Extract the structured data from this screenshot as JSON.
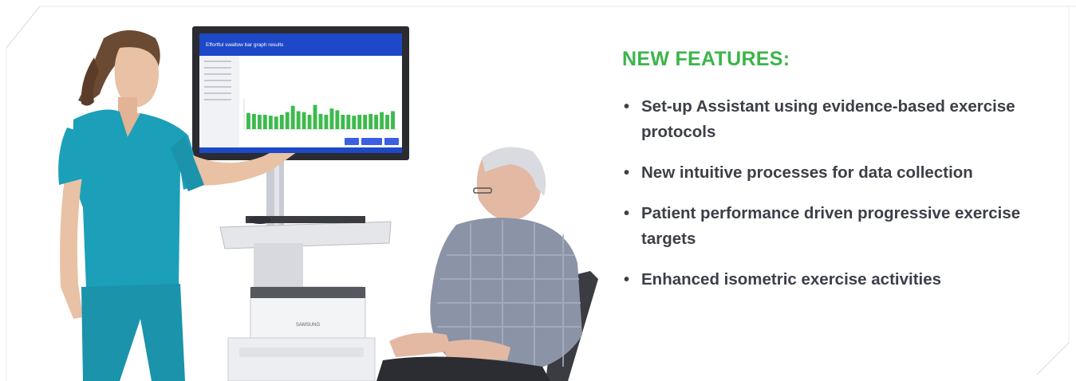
{
  "features": {
    "title": "NEW FEATURES:",
    "items": [
      {
        "label": "Set-up Assistant using evidence-based exercise protocols"
      },
      {
        "label": "New intuitive processes for data collection"
      },
      {
        "label": "Patient performance driven progressive exercise targets"
      },
      {
        "label": "Enhanced isometric exercise activities"
      }
    ]
  },
  "screen": {
    "title": "Effortful swallow bar graph results",
    "chart": {
      "values": [
        18,
        17,
        16,
        16,
        15,
        14,
        16,
        19,
        26,
        20,
        19,
        16,
        27,
        17,
        16,
        23,
        21,
        16,
        16,
        15,
        16,
        16,
        17,
        16,
        19,
        16,
        20
      ],
      "ymax": 32,
      "bar_color": "#3dbb4c"
    }
  },
  "colors": {
    "accent_green": "#3cb54a",
    "text_dark": "#3c3f48",
    "screen_blue": "#1d48c7",
    "scrub_teal": "#1c9fb8"
  },
  "device": {
    "printer_brand": "SAMSUNG"
  }
}
